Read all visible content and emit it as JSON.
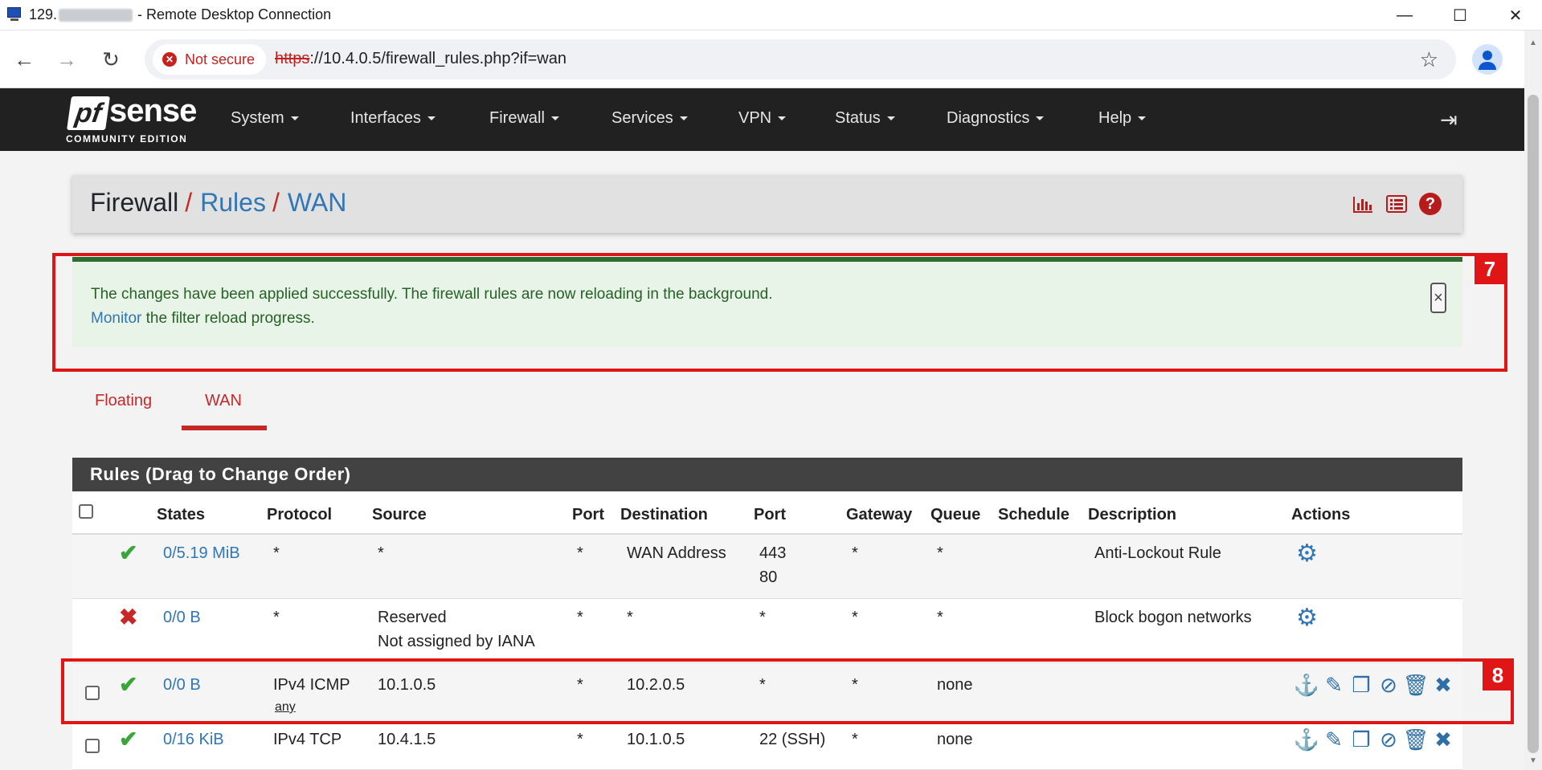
{
  "window": {
    "title_prefix": "129.",
    "title_suffix": "- Remote Desktop Connection",
    "minimize": "—",
    "maximize": "☐",
    "close": "✕"
  },
  "browser": {
    "back": "←",
    "forward": "→",
    "reload": "↻",
    "security_label": "Not secure",
    "url_scheme": "https",
    "url_rest": "://10.4.0.5/firewall_rules.php?if=wan",
    "bookmark": "☆"
  },
  "nav": {
    "logo_pf": "pf",
    "logo_sense": "sense",
    "logo_edition": "COMMUNITY EDITION",
    "items": [
      "System",
      "Interfaces",
      "Firewall",
      "Services",
      "VPN",
      "Status",
      "Diagnostics",
      "Help"
    ],
    "logout": "⇥"
  },
  "breadcrumb": {
    "root": "Firewall",
    "slash": "/",
    "level1": "Rules",
    "level2": "WAN"
  },
  "alert": {
    "line1": "The changes have been applied successfully. The firewall rules are now reloading in the background.",
    "monitor_link": "Monitor",
    "line2_rest": " the filter reload progress.",
    "close": "×"
  },
  "annotations": {
    "alert_label": "7",
    "row_label": "8"
  },
  "tabs": [
    "Floating",
    "WAN"
  ],
  "rules": {
    "title": "Rules (Drag to Change Order)",
    "columns": [
      "States",
      "Protocol",
      "Source",
      "Port",
      "Destination",
      "Port",
      "Gateway",
      "Queue",
      "Schedule",
      "Description",
      "Actions"
    ],
    "rows": [
      {
        "states": "0/5.19 MiB",
        "protocol": "*",
        "source": "*",
        "source_sub": "",
        "sport": "*",
        "dest": "WAN Address",
        "dport": "443",
        "dport2": "80",
        "gateway": "*",
        "queue": "*",
        "schedule": "",
        "description": "Anti-Lockout Rule",
        "protocol_sub": ""
      },
      {
        "states": "0/0 B",
        "protocol": "*",
        "source": "Reserved",
        "source_sub": "Not assigned by IANA",
        "sport": "*",
        "dest": "*",
        "dport": "*",
        "dport2": "",
        "gateway": "*",
        "queue": "*",
        "schedule": "",
        "description": "Block bogon networks",
        "protocol_sub": ""
      },
      {
        "states": "0/0 B",
        "protocol": "IPv4 ICMP",
        "protocol_sub": "any",
        "source": "10.1.0.5",
        "source_sub": "",
        "sport": "*",
        "dest": "10.2.0.5",
        "dport": "*",
        "dport2": "",
        "gateway": "*",
        "queue": "none",
        "schedule": "",
        "description": ""
      },
      {
        "states": "0/16 KiB",
        "protocol": "IPv4 TCP",
        "protocol_sub": "",
        "source": "10.4.1.5",
        "source_sub": "",
        "sport": "*",
        "dest": "10.1.0.5",
        "dport": "22 (SSH)",
        "dport2": "",
        "gateway": "*",
        "queue": "none",
        "schedule": "",
        "description": ""
      }
    ]
  }
}
